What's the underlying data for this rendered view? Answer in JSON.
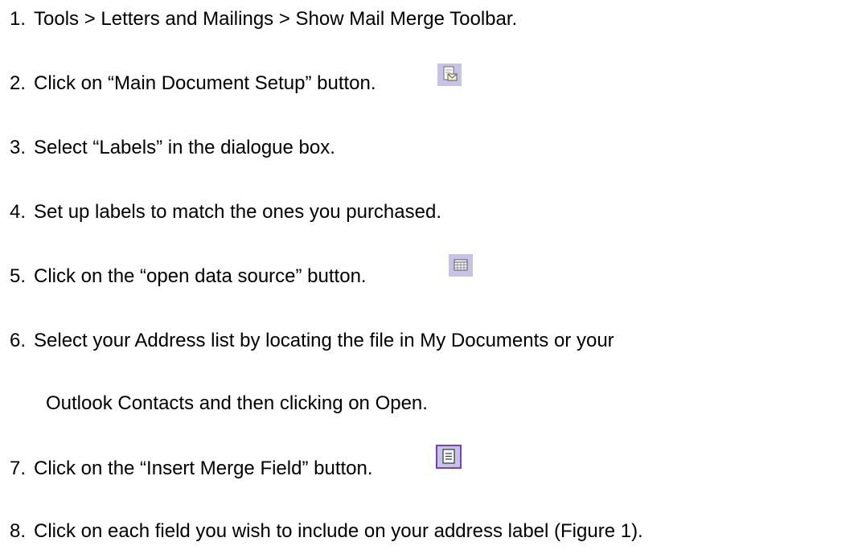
{
  "steps": [
    {
      "number": "1.",
      "text": "Tools > Letters and Mailings > Show Mail Merge Toolbar."
    },
    {
      "number": "2.",
      "text": "Click on “Main Document Setup” button.",
      "icon": "main-document-setup-icon"
    },
    {
      "number": "3.",
      "text": "Select “Labels” in the dialogue box."
    },
    {
      "number": "4.",
      "text": "Set up labels to match the ones you purchased."
    },
    {
      "number": "5.",
      "text": "Click on the “open data source” button.",
      "icon": "open-data-source-icon"
    },
    {
      "number": "6.",
      "text": "Select your Address list by locating the file in My Documents or your",
      "continuation": "Outlook Contacts and then clicking on Open."
    },
    {
      "number": "7.",
      "text": "Click on the “Insert Merge Field” button.",
      "icon": "insert-merge-field-icon"
    },
    {
      "number": "8.",
      "text": "Click on each field you wish to include on your address label (Figure 1)."
    }
  ],
  "colors": {
    "text": "#000000",
    "icon_background": "#c6c3e6",
    "icon_border_accent": "#7b3fbf"
  }
}
